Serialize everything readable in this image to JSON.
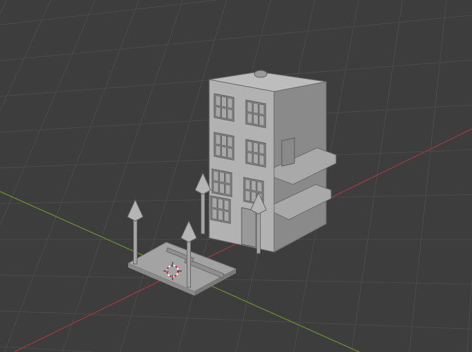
{
  "viewport": {
    "background": "#3d3d3d",
    "grid_color": "#4a4a4a",
    "x_axis_color": "#9b3b3f",
    "y_axis_color": "#6a8f2f",
    "model_light": "#b4b4b4",
    "model_mid": "#9a9a9a",
    "model_dark": "#7c7c7c"
  }
}
